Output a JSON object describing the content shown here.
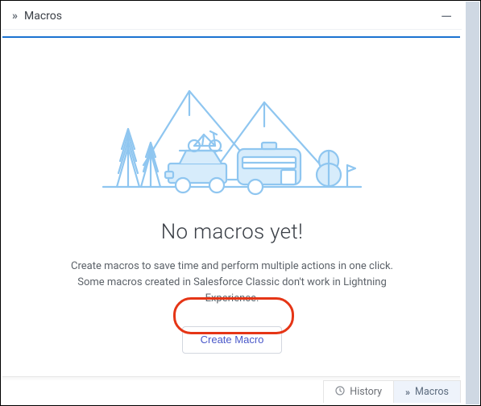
{
  "panel": {
    "title": "Macros",
    "minimize_label": "—"
  },
  "empty_state": {
    "headline": "No macros yet!",
    "subtext": "Create macros to save time and perform multiple actions in one click. Some macros created in Salesforce Classic don't work in Lightning Experience.",
    "create_button_label": "Create Macro"
  },
  "footer": {
    "history_label": "History",
    "macros_label": "Macros"
  }
}
